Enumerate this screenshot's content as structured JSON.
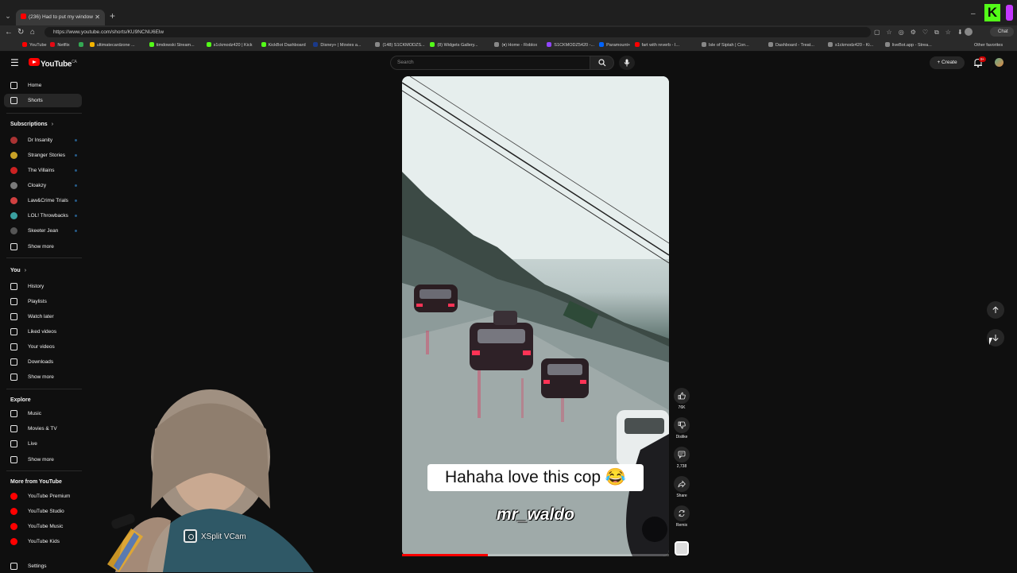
{
  "browser": {
    "tab_title": "(236) Had to put my window",
    "url": "https://www.youtube.com/shorts/KU9NCNU6Elw",
    "chat_label": "Chat",
    "other_favorites": "Other favorites",
    "bookmarks": [
      {
        "label": "YouTube",
        "color": "#ff0000"
      },
      {
        "label": "Netflix",
        "color": "#e50914"
      },
      {
        "label": "",
        "color": "#34a853"
      },
      {
        "label": "ultimatecardzone ...",
        "color": "#f4b400"
      },
      {
        "label": "timdowski Stream...",
        "color": "#53fc18"
      },
      {
        "label": "s1ckmodz420 | Kick",
        "color": "#53fc18"
      },
      {
        "label": "KickBot Dashboard",
        "color": "#53fc18"
      },
      {
        "label": "Disney+ | Movies a...",
        "color": "#1a3a8a"
      },
      {
        "label": "(148) S1CKMODZS...",
        "color": "#888888"
      },
      {
        "label": "(8) Widgets Gallery...",
        "color": "#53fc18"
      },
      {
        "label": "(♦) Home - Roblox",
        "color": "#888888"
      },
      {
        "label": "S1CKMODZ5420 -...",
        "color": "#9146ff"
      },
      {
        "label": "Paramount+",
        "color": "#0064ff"
      },
      {
        "label": "fart with reverb - I...",
        "color": "#ff0000"
      },
      {
        "label": "Isle of Siptah | Con...",
        "color": "#888888"
      },
      {
        "label": "Dashboard - Treat...",
        "color": "#888888"
      },
      {
        "label": "s1ckmodz420 - Ki...",
        "color": "#888888"
      },
      {
        "label": "liveBot.app - Strea...",
        "color": "#888888"
      }
    ]
  },
  "masthead": {
    "logo_text": "YouTube",
    "logo_sup": "CA",
    "search_placeholder": "Search",
    "create_label": "Create",
    "notif_count": "9+"
  },
  "sidebar": {
    "main": [
      {
        "label": "Home",
        "icon": "home-icon",
        "active": false
      },
      {
        "label": "Shorts",
        "icon": "shorts-icon",
        "active": true
      }
    ],
    "subs_heading": "Subscriptions",
    "subscriptions": [
      {
        "label": "Dr Insanity",
        "color": "#aa3333"
      },
      {
        "label": "Stranger Stories",
        "color": "#c9a227"
      },
      {
        "label": "The Villains",
        "color": "#cc2222"
      },
      {
        "label": "Cloakzy",
        "color": "#7a7a7a"
      },
      {
        "label": "Law&Crime Trials",
        "color": "#d04040"
      },
      {
        "label": "LOL! Throwbacks",
        "color": "#3aa0a0"
      },
      {
        "label": "Skeeter Jean",
        "color": "#555555"
      }
    ],
    "subs_more": "Show more",
    "you_heading": "You",
    "you_items": [
      {
        "label": "History",
        "icon": "history-icon"
      },
      {
        "label": "Playlists",
        "icon": "playlists-icon"
      },
      {
        "label": "Watch later",
        "icon": "watch-later-icon"
      },
      {
        "label": "Liked videos",
        "icon": "like-icon"
      },
      {
        "label": "Your videos",
        "icon": "your-videos-icon"
      },
      {
        "label": "Downloads",
        "icon": "download-icon"
      }
    ],
    "you_more": "Show more",
    "explore_heading": "Explore",
    "explore_items": [
      {
        "label": "Music",
        "icon": "music-icon"
      },
      {
        "label": "Movies & TV",
        "icon": "movies-icon"
      },
      {
        "label": "Live",
        "icon": "live-icon"
      }
    ],
    "explore_more": "Show more",
    "more_heading": "More from YouTube",
    "more_items": [
      {
        "label": "YouTube Premium",
        "color": "#ff0000"
      },
      {
        "label": "YouTube Studio",
        "color": "#ff0000"
      },
      {
        "label": "YouTube Music",
        "color": "#ff0000"
      },
      {
        "label": "YouTube Kids",
        "color": "#ff0000"
      }
    ],
    "settings_label": "Settings"
  },
  "short": {
    "username_overlay": "mr_waldo",
    "caption": "Hahaha love this cop 😂",
    "progress_fraction": 0.32
  },
  "actions": {
    "like_count": "76K",
    "dislike_label": "Dislike",
    "comment_count": "2,738",
    "share_label": "Share",
    "remix_label": "Remix"
  },
  "overlay": {
    "xsplit_label": "XSplit VCam"
  }
}
